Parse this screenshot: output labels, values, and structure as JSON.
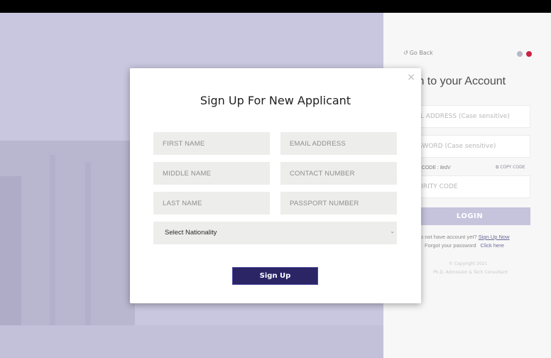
{
  "modal": {
    "title": "Sign Up For New Applicant",
    "close_icon": "×",
    "fields": {
      "first_name": "FIRST NAME",
      "email": "EMAIL ADDRESS",
      "middle_name": "MIDDLE NAME",
      "contact": "CONTACT NUMBER",
      "last_name": "LAST NAME",
      "passport": "PASSPORT NUMBER"
    },
    "nationality_select": "Select Nationality",
    "signup_label": "Sign Up"
  },
  "login": {
    "go_back": "Go Back",
    "heading": "gin to your Account",
    "email_placeholder": "AIL ADDRESS (Case sensitive)",
    "password_placeholder": "SSWORD (Case sensitive)",
    "security_label": "RITY CODE : 8rdV",
    "copy_code": "COPY CODE",
    "security_placeholder": "CURITY CODE",
    "login_label": "LOGIN",
    "no_account_text": "o not have account yet?",
    "signup_link": "Sign Up Now",
    "forgot_text": "Forgot your password",
    "click_here": "Click here",
    "copyright1": "© Copyright 2021",
    "copyright2": "Ph.D. Admission & Tech Consultant"
  },
  "colors": {
    "primary": "#2b2566",
    "hero_overlay": "#c9c7df",
    "login_button": "#c6c3dd"
  }
}
